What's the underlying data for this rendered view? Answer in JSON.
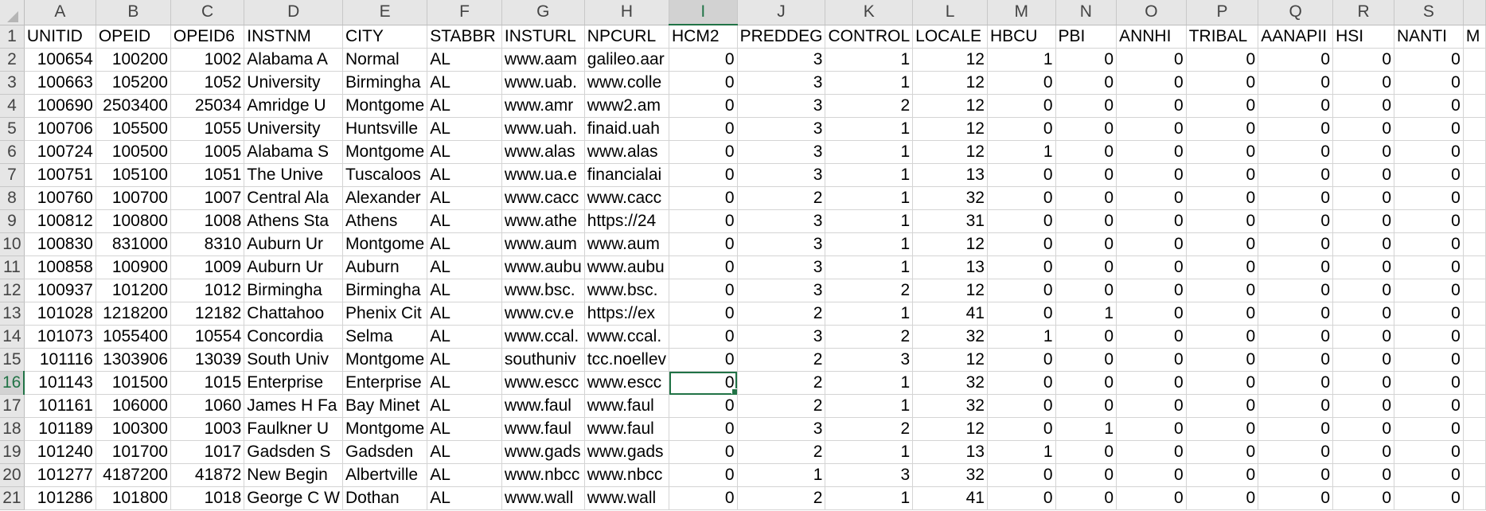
{
  "sheet": {
    "selected_cell": "I16",
    "selected_row": "16",
    "selected_col": "I",
    "columns": [
      {
        "letter": "A",
        "type": "num"
      },
      {
        "letter": "B",
        "type": "num"
      },
      {
        "letter": "C",
        "type": "num"
      },
      {
        "letter": "D",
        "type": "txt"
      },
      {
        "letter": "E",
        "type": "txt"
      },
      {
        "letter": "F",
        "type": "txt"
      },
      {
        "letter": "G",
        "type": "txt"
      },
      {
        "letter": "H",
        "type": "txt"
      },
      {
        "letter": "I",
        "type": "num"
      },
      {
        "letter": "J",
        "type": "num"
      },
      {
        "letter": "K",
        "type": "num"
      },
      {
        "letter": "L",
        "type": "num"
      },
      {
        "letter": "M",
        "type": "num"
      },
      {
        "letter": "N",
        "type": "num"
      },
      {
        "letter": "O",
        "type": "num"
      },
      {
        "letter": "P",
        "type": "num"
      },
      {
        "letter": "Q",
        "type": "num"
      },
      {
        "letter": "R",
        "type": "num"
      },
      {
        "letter": "S",
        "type": "num"
      },
      {
        "letter": "",
        "type": "txt"
      }
    ],
    "rows": [
      {
        "num": "1",
        "cells": [
          "UNITID",
          "OPEID",
          "OPEID6",
          "INSTNM",
          "CITY",
          "STABBR",
          "INSTURL",
          "NPCURL",
          "HCM2",
          "PREDDEG",
          "CONTROL",
          "LOCALE",
          "HBCU",
          "PBI",
          "ANNHI",
          "TRIBAL",
          "AANAPII",
          "HSI",
          "NANTI",
          "M"
        ]
      },
      {
        "num": "2",
        "cells": [
          "100654",
          "100200",
          "1002",
          "Alabama A",
          "Normal",
          "AL",
          "www.aam",
          "galileo.aar",
          "0",
          "3",
          "1",
          "12",
          "1",
          "0",
          "0",
          "0",
          "0",
          "0",
          "0",
          ""
        ]
      },
      {
        "num": "3",
        "cells": [
          "100663",
          "105200",
          "1052",
          "University",
          "Birmingha",
          "AL",
          "www.uab.",
          "www.colle",
          "0",
          "3",
          "1",
          "12",
          "0",
          "0",
          "0",
          "0",
          "0",
          "0",
          "0",
          ""
        ]
      },
      {
        "num": "4",
        "cells": [
          "100690",
          "2503400",
          "25034",
          "Amridge U",
          "Montgome",
          "AL",
          "www.amr",
          "www2.am",
          "0",
          "3",
          "2",
          "12",
          "0",
          "0",
          "0",
          "0",
          "0",
          "0",
          "0",
          ""
        ]
      },
      {
        "num": "5",
        "cells": [
          "100706",
          "105500",
          "1055",
          "University",
          "Huntsville",
          "AL",
          "www.uah.",
          "finaid.uah",
          "0",
          "3",
          "1",
          "12",
          "0",
          "0",
          "0",
          "0",
          "0",
          "0",
          "0",
          ""
        ]
      },
      {
        "num": "6",
        "cells": [
          "100724",
          "100500",
          "1005",
          "Alabama S",
          "Montgome",
          "AL",
          "www.alas",
          "www.alas",
          "0",
          "3",
          "1",
          "12",
          "1",
          "0",
          "0",
          "0",
          "0",
          "0",
          "0",
          ""
        ]
      },
      {
        "num": "7",
        "cells": [
          "100751",
          "105100",
          "1051",
          "The Unive",
          "Tuscaloos",
          "AL",
          "www.ua.e",
          "financialai",
          "0",
          "3",
          "1",
          "13",
          "0",
          "0",
          "0",
          "0",
          "0",
          "0",
          "0",
          ""
        ]
      },
      {
        "num": "8",
        "cells": [
          "100760",
          "100700",
          "1007",
          "Central Ala",
          "Alexander",
          "AL",
          "www.cacc",
          "www.cacc",
          "0",
          "2",
          "1",
          "32",
          "0",
          "0",
          "0",
          "0",
          "0",
          "0",
          "0",
          ""
        ]
      },
      {
        "num": "9",
        "cells": [
          "100812",
          "100800",
          "1008",
          "Athens Sta",
          "Athens",
          "AL",
          "www.athe",
          "https://24",
          "0",
          "3",
          "1",
          "31",
          "0",
          "0",
          "0",
          "0",
          "0",
          "0",
          "0",
          ""
        ]
      },
      {
        "num": "10",
        "cells": [
          "100830",
          "831000",
          "8310",
          "Auburn Ur",
          "Montgome",
          "AL",
          "www.aum",
          "www.aum",
          "0",
          "3",
          "1",
          "12",
          "0",
          "0",
          "0",
          "0",
          "0",
          "0",
          "0",
          ""
        ]
      },
      {
        "num": "11",
        "cells": [
          "100858",
          "100900",
          "1009",
          "Auburn Ur",
          "Auburn",
          "AL",
          "www.aubu",
          "www.aubu",
          "0",
          "3",
          "1",
          "13",
          "0",
          "0",
          "0",
          "0",
          "0",
          "0",
          "0",
          ""
        ]
      },
      {
        "num": "12",
        "cells": [
          "100937",
          "101200",
          "1012",
          "Birmingha",
          "Birmingha",
          "AL",
          "www.bsc.",
          "www.bsc.",
          "0",
          "3",
          "2",
          "12",
          "0",
          "0",
          "0",
          "0",
          "0",
          "0",
          "0",
          ""
        ]
      },
      {
        "num": "13",
        "cells": [
          "101028",
          "1218200",
          "12182",
          "Chattahoo",
          "Phenix Cit",
          "AL",
          "www.cv.e",
          "https://ex",
          "0",
          "2",
          "1",
          "41",
          "0",
          "1",
          "0",
          "0",
          "0",
          "0",
          "0",
          ""
        ]
      },
      {
        "num": "14",
        "cells": [
          "101073",
          "1055400",
          "10554",
          "Concordia",
          "Selma",
          "AL",
          "www.ccal.",
          "www.ccal.",
          "0",
          "3",
          "2",
          "32",
          "1",
          "0",
          "0",
          "0",
          "0",
          "0",
          "0",
          ""
        ]
      },
      {
        "num": "15",
        "cells": [
          "101116",
          "1303906",
          "13039",
          "South Univ",
          "Montgome",
          "AL",
          "southuniv",
          "tcc.noellev",
          "0",
          "2",
          "3",
          "12",
          "0",
          "0",
          "0",
          "0",
          "0",
          "0",
          "0",
          ""
        ]
      },
      {
        "num": "16",
        "cells": [
          "101143",
          "101500",
          "1015",
          "Enterprise",
          "Enterprise",
          "AL",
          "www.escc",
          "www.escc",
          "0",
          "2",
          "1",
          "32",
          "0",
          "0",
          "0",
          "0",
          "0",
          "0",
          "0",
          ""
        ]
      },
      {
        "num": "17",
        "cells": [
          "101161",
          "106000",
          "1060",
          "James H Fa",
          "Bay Minet",
          "AL",
          "www.faul",
          "www.faul",
          "0",
          "2",
          "1",
          "32",
          "0",
          "0",
          "0",
          "0",
          "0",
          "0",
          "0",
          ""
        ]
      },
      {
        "num": "18",
        "cells": [
          "101189",
          "100300",
          "1003",
          "Faulkner U",
          "Montgome",
          "AL",
          "www.faul",
          "www.faul",
          "0",
          "3",
          "2",
          "12",
          "0",
          "1",
          "0",
          "0",
          "0",
          "0",
          "0",
          ""
        ]
      },
      {
        "num": "19",
        "cells": [
          "101240",
          "101700",
          "1017",
          "Gadsden S",
          "Gadsden",
          "AL",
          "www.gads",
          "www.gads",
          "0",
          "2",
          "1",
          "13",
          "1",
          "0",
          "0",
          "0",
          "0",
          "0",
          "0",
          ""
        ]
      },
      {
        "num": "20",
        "cells": [
          "101277",
          "4187200",
          "41872",
          "New Begin",
          "Albertville",
          "AL",
          "www.nbcc",
          "www.nbcc",
          "0",
          "1",
          "3",
          "32",
          "0",
          "0",
          "0",
          "0",
          "0",
          "0",
          "0",
          ""
        ]
      },
      {
        "num": "21",
        "cells": [
          "101286",
          "101800",
          "1018",
          "George C W",
          "Dothan",
          "AL",
          "www.wall",
          "www.wall",
          "0",
          "2",
          "1",
          "41",
          "0",
          "0",
          "0",
          "0",
          "0",
          "0",
          "0",
          ""
        ]
      }
    ]
  }
}
